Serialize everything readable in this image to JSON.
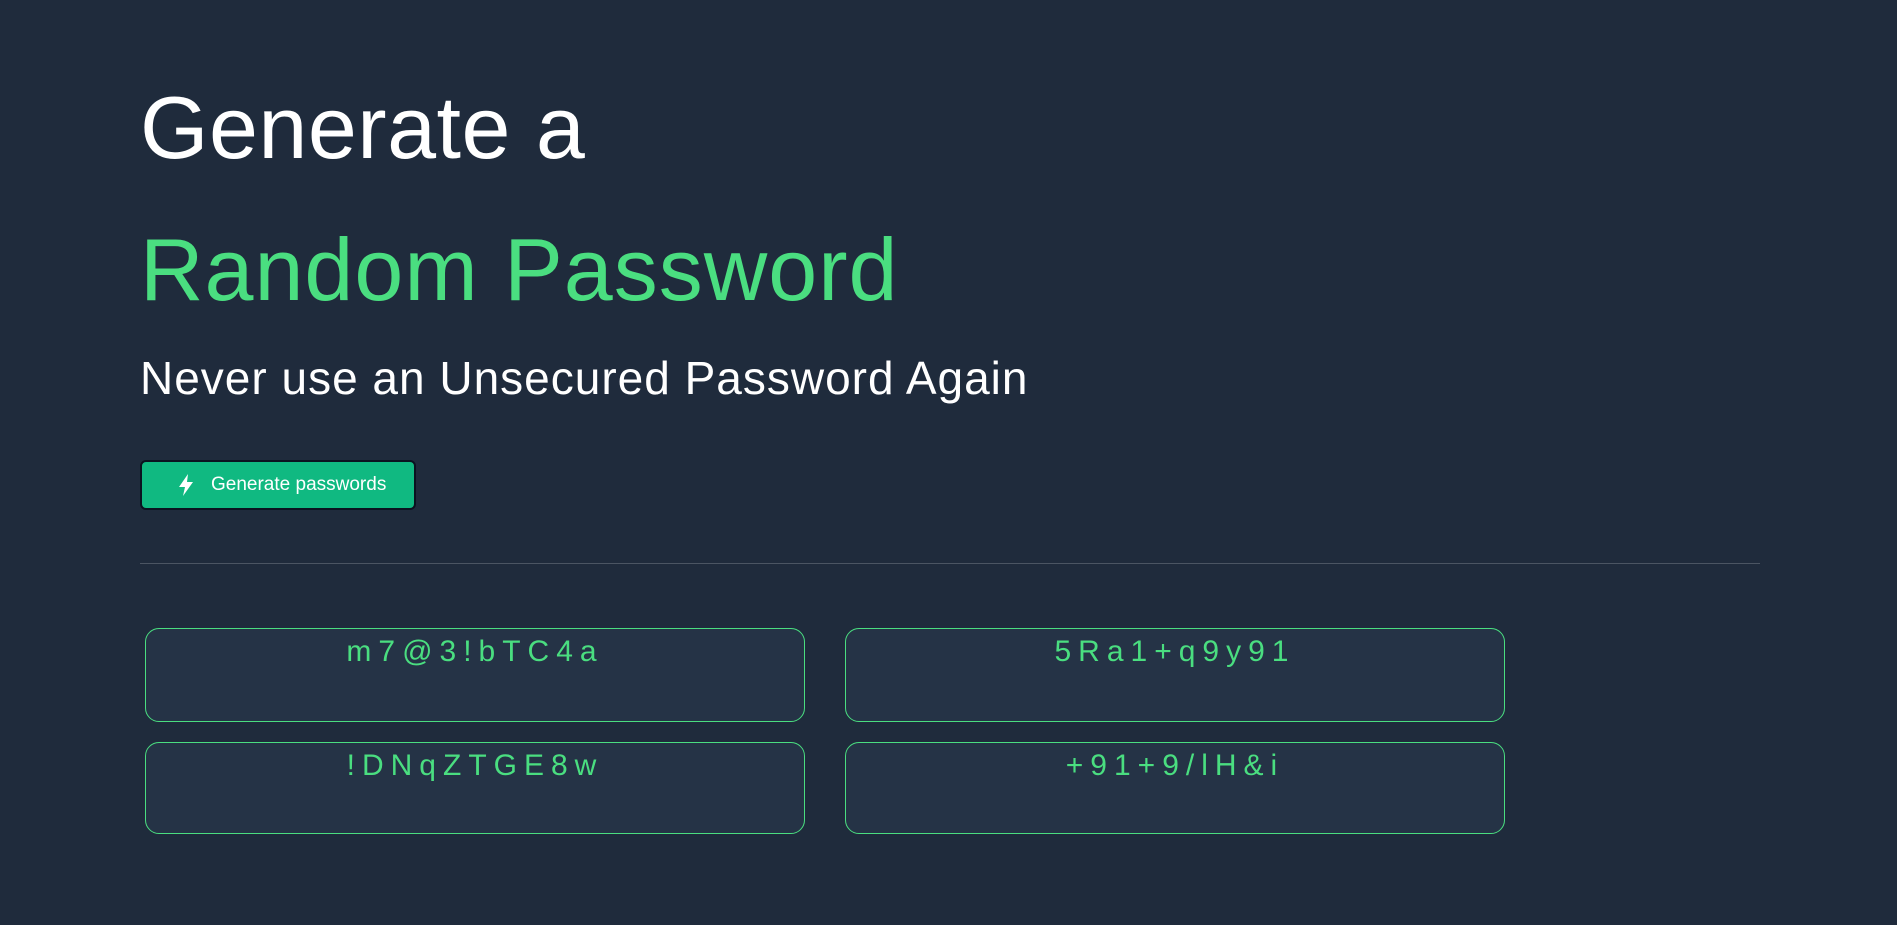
{
  "hero": {
    "title_line1": "Generate a",
    "title_line2": "Random Password",
    "subtitle": "Never use an Unsecured Password Again"
  },
  "actions": {
    "generate_label": "Generate passwords",
    "generate_icon": "lightning-bolt-icon"
  },
  "passwords": [
    "m7@3!bTC4a",
    "5Ra1+q9y91",
    "!DNqZTGE8w",
    "+91+9/lH&i"
  ],
  "colors": {
    "background": "#1f2b3c",
    "accent_green": "#4ade80",
    "button_green": "#10b981",
    "card_background": "#253346"
  }
}
